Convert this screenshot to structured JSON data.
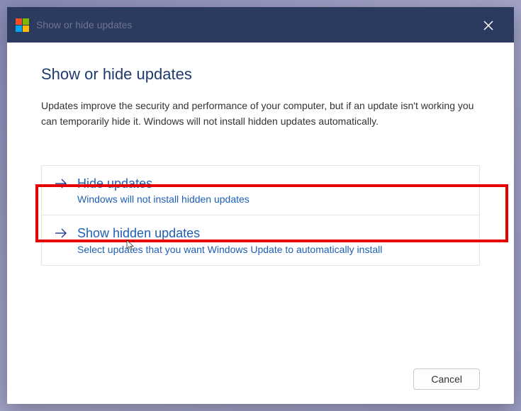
{
  "titlebar": {
    "title": "Show or hide updates"
  },
  "content": {
    "heading": "Show or hide updates",
    "description": "Updates improve the security and performance of your computer, but if an update isn't working you can temporarily hide it. Windows will not install hidden updates automatically."
  },
  "options": [
    {
      "title": "Hide updates",
      "subtitle": "Windows will not install hidden updates"
    },
    {
      "title": "Show hidden updates",
      "subtitle": "Select updates that you want Windows Update to automatically install"
    }
  ],
  "footer": {
    "cancel": "Cancel"
  }
}
